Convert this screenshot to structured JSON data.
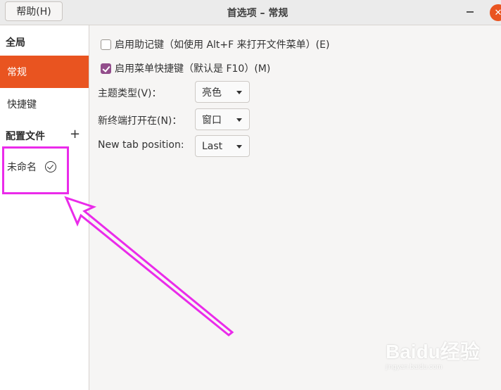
{
  "titlebar": {
    "help_label": "帮助(H)",
    "title": "首选项 – 常规",
    "close_glyph": "✕"
  },
  "sidebar": {
    "global_heading": "全局",
    "items": [
      {
        "label": "常规",
        "selected": true
      },
      {
        "label": "快捷键",
        "selected": false
      }
    ],
    "profiles_heading": "配置文件",
    "add_glyph": "+",
    "profiles": [
      {
        "label": "未命名",
        "default": true
      }
    ]
  },
  "main": {
    "mnemonics_label": "启用助记键（如使用 Alt+F 来打开文件菜单）(E)",
    "mnemonics_checked": false,
    "menu_accel_label": "启用菜单快捷键（默认是 F10）(M)",
    "menu_accel_checked": true,
    "theme_label": "主题类型(V)：",
    "theme_value": "亮色",
    "open_in_label": "新终端打开在(N)：",
    "open_in_value": "窗口",
    "tab_position_label": "New tab position:",
    "tab_position_value": "Last"
  },
  "annotation": {
    "color": "#ea2bea"
  },
  "watermark": {
    "brand": "Baidu经验",
    "url": "jingyan.baidu.com"
  },
  "colors": {
    "accent": "#e95420",
    "checkbox": "#924d8b"
  }
}
